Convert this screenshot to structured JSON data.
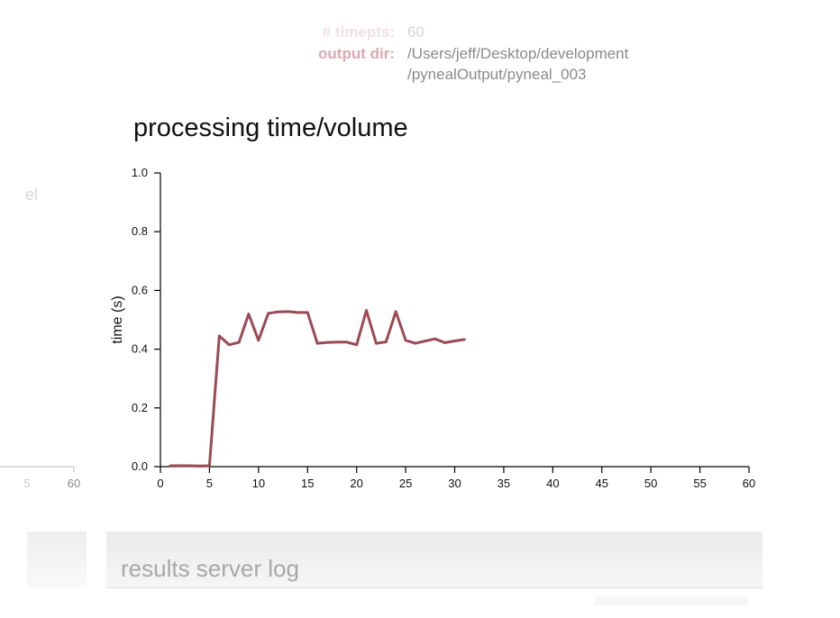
{
  "info": {
    "timepts_label": "# timepts:",
    "timepts_value": "60",
    "output_dir_label": "output dir:",
    "output_dir_line1": "/Users/jeff/Desktop/development",
    "output_dir_line2": "/pynealOutput/pyneal_003"
  },
  "left_panel": {
    "label_fragment": "el",
    "tick_labels": [
      "5",
      "60"
    ]
  },
  "log_panel": {
    "title": "results server log"
  },
  "colors": {
    "line": "#9b4a55",
    "axis": "#000000",
    "label_accent": "#d9a9b0"
  },
  "chart_data": {
    "type": "line",
    "title": "processing time/volume",
    "xlabel": "",
    "ylabel": "time (s)",
    "xlim": [
      0,
      60
    ],
    "ylim": [
      0,
      1.0
    ],
    "x_ticks": [
      0,
      5,
      10,
      15,
      20,
      25,
      30,
      35,
      40,
      45,
      50,
      55,
      60
    ],
    "y_ticks": [
      0.0,
      0.2,
      0.4,
      0.6,
      0.8,
      1.0
    ],
    "y_tick_labels": [
      "0.0",
      "0.2",
      "0.4",
      "0.6",
      "0.8",
      "1.0"
    ],
    "grid": false,
    "series": [
      {
        "x": [
          1,
          2,
          3,
          4,
          5,
          6,
          7,
          8,
          9,
          10,
          11,
          12,
          13,
          14,
          15,
          16,
          17,
          18,
          19,
          20,
          21,
          22,
          23,
          24,
          25,
          26,
          27,
          28,
          29,
          30,
          31
        ],
        "values": [
          0.003,
          0.003,
          0.003,
          0.002,
          0.003,
          0.445,
          0.415,
          0.423,
          0.52,
          0.43,
          0.522,
          0.527,
          0.528,
          0.525,
          0.525,
          0.42,
          0.423,
          0.424,
          0.424,
          0.415,
          0.532,
          0.42,
          0.425,
          0.528,
          0.43,
          0.42,
          0.428,
          0.435,
          0.422,
          0.428,
          0.433
        ]
      }
    ]
  }
}
